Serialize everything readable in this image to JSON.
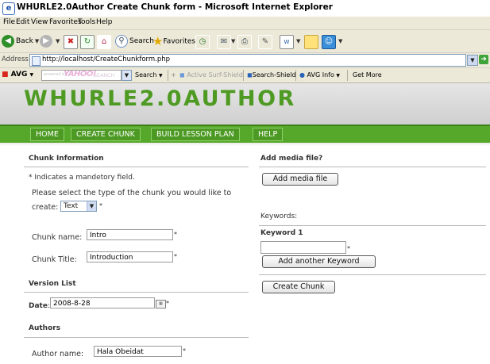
{
  "window": {
    "title": "WHURLE2.0Author Create Chunk form - Microsoft Internet Explorer"
  },
  "menubar": {
    "items": [
      "File",
      "Edit",
      "View",
      "Favorites",
      "Tools",
      "Help"
    ]
  },
  "toolbar": {
    "back_label": "Back",
    "search_label": "Search",
    "favorites_label": "Favorites"
  },
  "address": {
    "label": "Address",
    "url": "http://localhost/CreateChunkform.php",
    "go_label": "G"
  },
  "avgbar": {
    "avg_label": "AVG",
    "powered_by": "powered by",
    "yahoo_label": "YAHOO!",
    "yahoo_search": "SEARCH",
    "search_label": "Search",
    "active_surf_label": "Active Surf-Shield",
    "search_shield_label": "Search-Shield",
    "avg_info_label": "AVG Info",
    "get_more_label": "Get More"
  },
  "site": {
    "title": "WHURLE2.0AUTHOR"
  },
  "nav": {
    "items": [
      "HOME",
      "CREATE CHUNK",
      "BUILD LESSON PLAN",
      "HELP"
    ]
  },
  "form": {
    "chunk_info_heading": "Chunk Information",
    "mandatory_note": "* Indicates a mandetory field.",
    "select_type_prompt_1": "Please select the type of the chunk you would like to",
    "select_type_prompt_2": "create:",
    "chunk_type": "Text",
    "chunk_name_label": "Chunk name:",
    "chunk_name_value": "Intro",
    "chunk_title_label": "Chunk Title:",
    "chunk_title_value": "Introduction",
    "version_heading": "Version List",
    "date_label": "Date",
    "date_value": "2008-8-28",
    "authors_heading": "Authors",
    "author_name_label": "Author name:",
    "author_name_value": "Hala Obeidat",
    "required_mark": "*"
  },
  "right": {
    "media_heading": "Add media file?",
    "add_media_button": "Add media file",
    "keywords_heading": "Keywords:",
    "keyword1_label": "Keyword 1",
    "keyword1_value": "",
    "add_keyword_button": "Add another Keyword",
    "create_chunk_button": "Create Chunk"
  }
}
